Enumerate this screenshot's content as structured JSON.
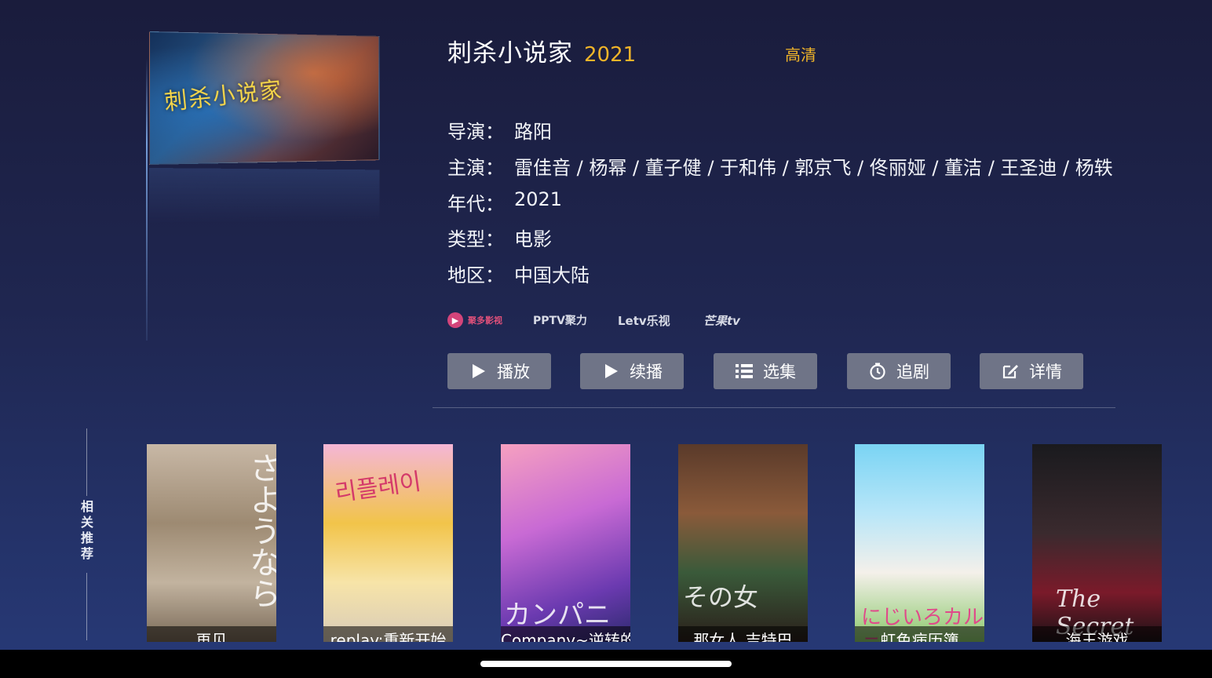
{
  "movie": {
    "title": "刺杀小说家",
    "year": "2021",
    "quality": "高清",
    "poster_text": "刺杀小说家"
  },
  "meta": {
    "director_label": "导演：",
    "director": "路阳",
    "cast_label": "主演：",
    "cast": "雷佳音 / 杨幂 / 董子健 / 于和伟 / 郭京飞 / 佟丽娅 / 董洁 / 王圣迪 / 杨轶",
    "year_label": "年代：",
    "year": "2021",
    "type_label": "类型：",
    "type": "电影",
    "region_label": "地区：",
    "region": "中国大陆"
  },
  "sources": [
    {
      "name": "聚多影视",
      "icon": "juduo-logo"
    },
    {
      "name": "PPTV聚力",
      "icon": "pptv-logo"
    },
    {
      "name": "Letv乐视",
      "icon": "letv-logo"
    },
    {
      "name": "芒果tv",
      "icon": "mango-logo"
    }
  ],
  "buttons": {
    "play": "播放",
    "resume": "续播",
    "episodes": "选集",
    "follow": "追剧",
    "detail": "详情"
  },
  "related": {
    "label": "相关推荐",
    "items": [
      {
        "title": "再见",
        "art_text": "さようなら"
      },
      {
        "title": "replay:重新开始",
        "art_text": "리플레이"
      },
      {
        "title": "Company~逆转的天鹅~",
        "art_text": "カンパニー"
      },
      {
        "title": "那女人 吉特巴",
        "art_text": "その女"
      },
      {
        "title": "虹色病历簿",
        "art_text": "にじいろカルテ"
      },
      {
        "title": "海王游戏",
        "art_text": "The Secret"
      }
    ]
  },
  "colors": {
    "accent": "#f0b429",
    "button_bg": "#6f7487",
    "bg_top": "#1a1c3c",
    "bg_bottom": "#273a78"
  }
}
